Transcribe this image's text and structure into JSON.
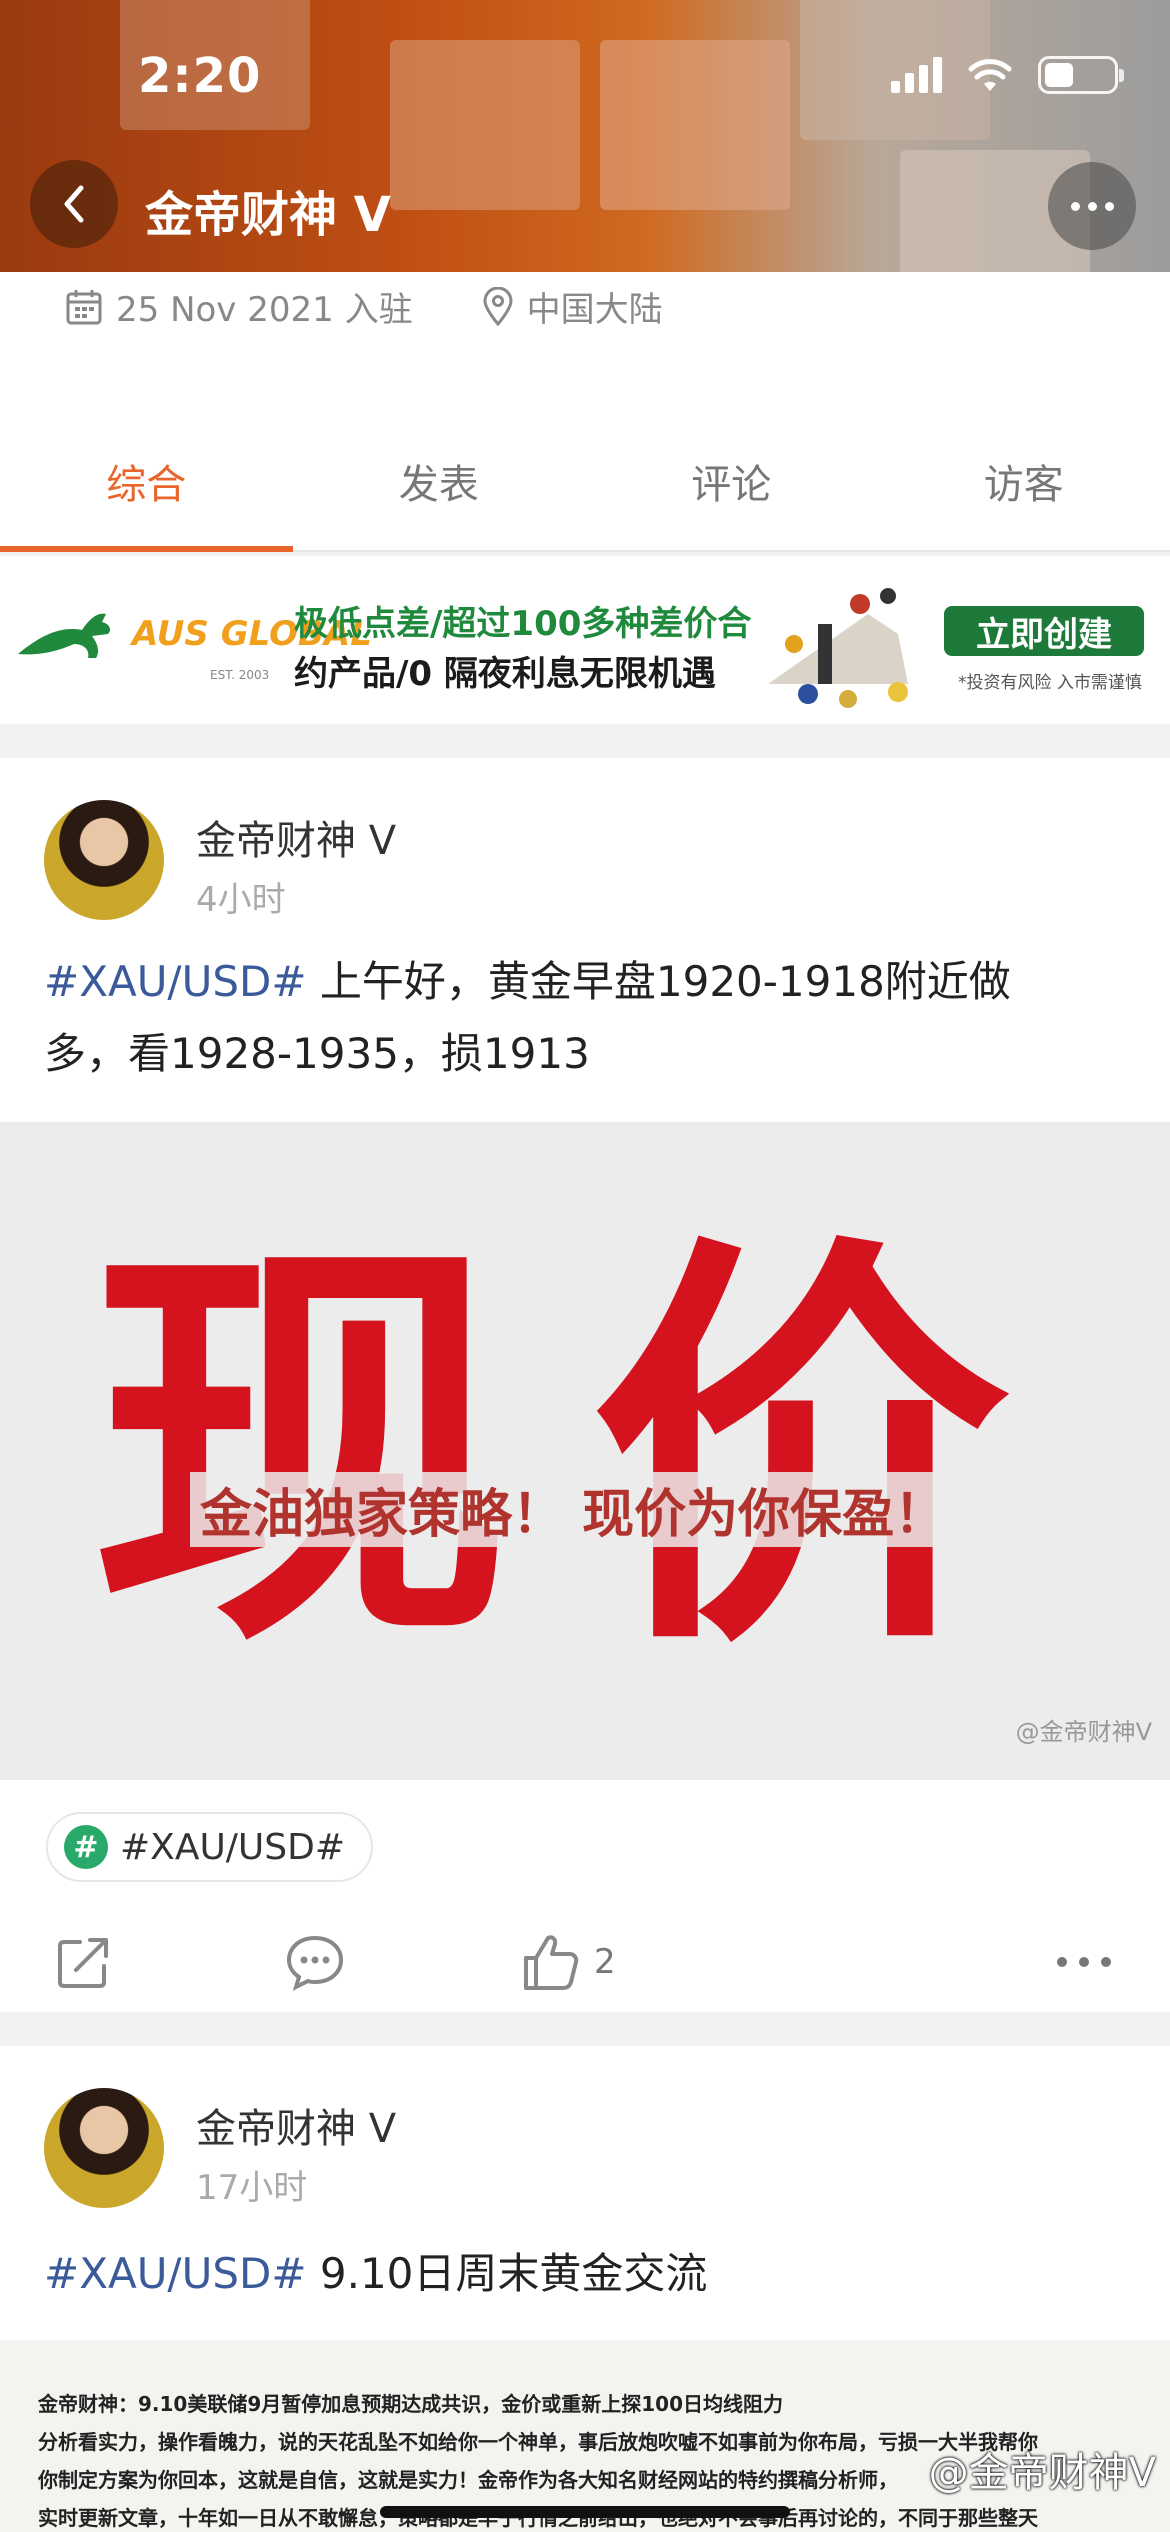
{
  "status_bar": {
    "time": "2:20"
  },
  "nav": {
    "title": "金帝财神 V"
  },
  "profile_meta": {
    "joined": "25 Nov 2021 入驻",
    "location": "中国大陆"
  },
  "tabs": [
    {
      "label": "综合",
      "active": true
    },
    {
      "label": "发表",
      "active": false
    },
    {
      "label": "评论",
      "active": false
    },
    {
      "label": "访客",
      "active": false
    }
  ],
  "ad": {
    "brand": "AUS GLOBAL",
    "brand_est": "EST. 2003",
    "line1": "极低点差/超过100多种差价合",
    "line2": "约产品/0 隔夜利息无限机遇",
    "button": "立即创建",
    "note": "*投资有风险 入市需谨慎"
  },
  "posts": [
    {
      "author": "金帝财神 V",
      "time": "4小时",
      "hashtag": "#XAU/USD#",
      "text_line1": " 上午好，黄金早盘1920-1918附近做",
      "text_line2": "多，看1928-1935，损1913",
      "image_big_left": "现",
      "image_big_right": "价",
      "image_caption": "金油独家策略！ 现价为你保盈！",
      "image_watermark": "@金帝财神V",
      "topic_chip": "#XAU/USD#",
      "likes": "2"
    },
    {
      "author": "金帝财神 V",
      "time": "17小时",
      "hashtag": "#XAU/USD#",
      "text": " 9.10日周末黄金交流",
      "doc_lines": [
        "金帝财神：9.10美联储9月暂停加息预期达成共识，金价或重新上探100日均线阻力",
        "分析看实力，操作看魄力，说的天花乱坠不如给你一个神单，事后放炮吹嘘不如事前为你布局，亏损一大半我帮你",
        "你制定方案为你回本，这就是自信，这就是实力！金帝作为各大知名财经网站的特约撰稿分析师，",
        "实时更新文章，十年如一日从不敢懈怠，策略都是早于行情之前给出，也绝对不会事后再讨论的，不同于那些整天"
      ],
      "image_watermark": "@金帝财神V"
    }
  ],
  "colors": {
    "accent": "#e8652c",
    "hashtag": "#3b5a9a",
    "ad_green": "#1d7a3a",
    "red_text": "#d4131f"
  }
}
